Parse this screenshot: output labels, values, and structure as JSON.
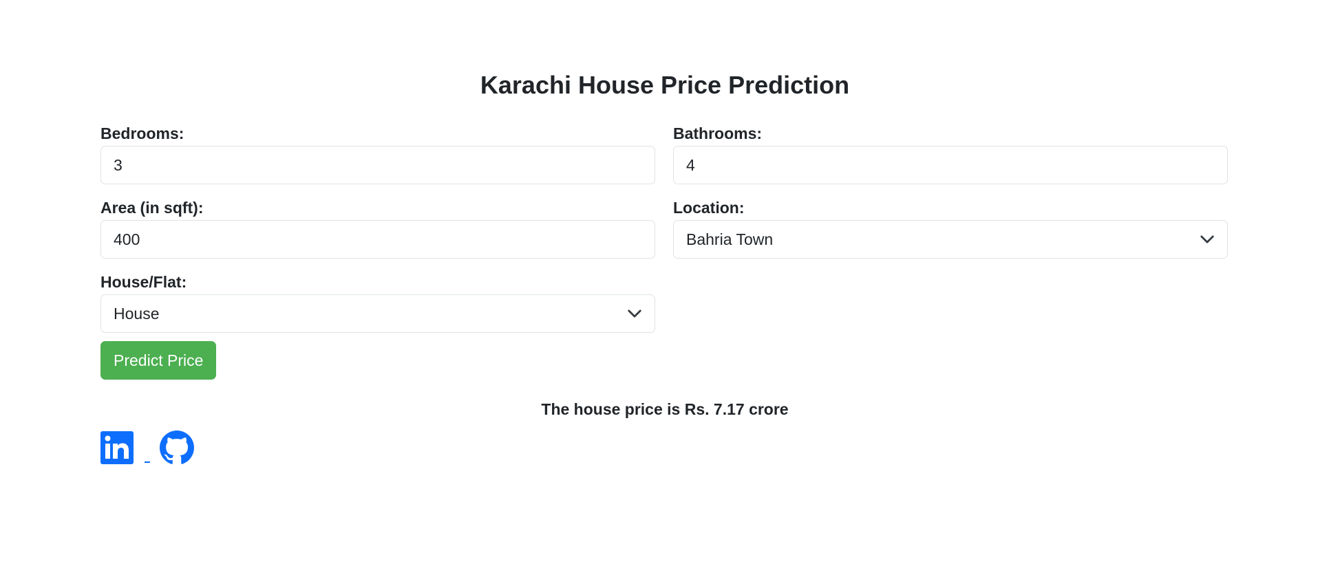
{
  "page": {
    "title": "Karachi House Price Prediction"
  },
  "form": {
    "bedrooms": {
      "label": "Bedrooms:",
      "value": "3"
    },
    "bathrooms": {
      "label": "Bathrooms:",
      "value": "4"
    },
    "area": {
      "label": "Area (in sqft):",
      "value": "400"
    },
    "location": {
      "label": "Location:",
      "value": "Bahria Town"
    },
    "house_flat": {
      "label": "House/Flat:",
      "value": "House"
    },
    "submit_label": "Predict Price"
  },
  "result": {
    "text": "The house price is Rs. 7.17 crore"
  },
  "social": {
    "icons": [
      "linkedin-icon",
      "github-icon"
    ],
    "color": "#0d6efd"
  },
  "colors": {
    "accent_button": "#4caf50",
    "text": "#212529",
    "border": "#dee2e6"
  }
}
